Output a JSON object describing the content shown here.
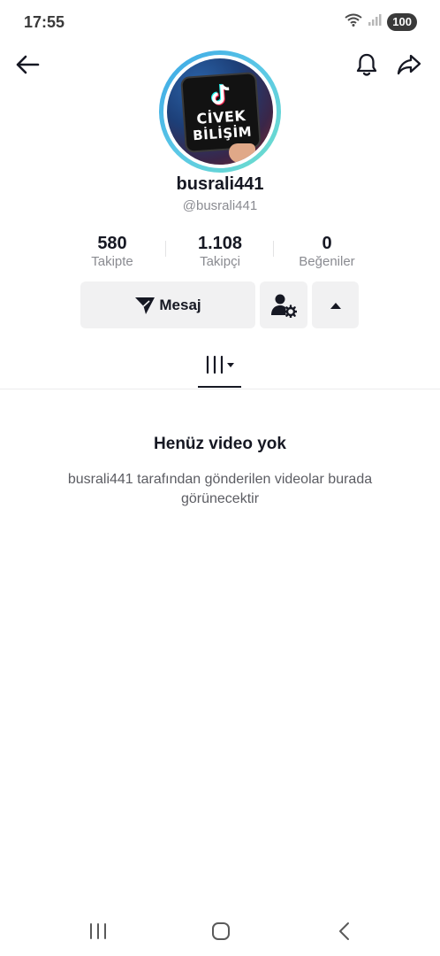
{
  "status_bar": {
    "time": "17:55",
    "battery": "100",
    "icons": [
      "wifi-icon",
      "signal-icon",
      "battery-icon"
    ]
  },
  "top_bar": {
    "icons": [
      "back-arrow-icon",
      "bell-icon",
      "share-icon"
    ]
  },
  "profile": {
    "avatar_sign_line1": "CİVEK",
    "avatar_sign_line2": "BİLİŞİM",
    "username": "busrali441",
    "handle": "@busrali441"
  },
  "stats": [
    {
      "value": "580",
      "label": "Takipte"
    },
    {
      "value": "1.108",
      "label": "Takipçi"
    },
    {
      "value": "0",
      "label": "Beğeniler"
    }
  ],
  "actions": {
    "message_label": "Mesaj",
    "icons": [
      "send-icon",
      "user-settings-icon",
      "caret-up-icon"
    ]
  },
  "tabs": {
    "active_icon": "videos-grid-icon"
  },
  "empty_state": {
    "title": "Henüz video yok",
    "description": "busrali441 tarafından gönderilen videolar burada görünecektir"
  },
  "nav_bar": {
    "icons": [
      "recent-apps-icon",
      "home-icon",
      "back-icon"
    ]
  },
  "colors": {
    "text_primary": "#161823",
    "text_secondary": "#8a8b91",
    "button_bg": "#f1f1f2",
    "avatar_ring_start": "#3ba6e6",
    "avatar_ring_end": "#6ee0c9"
  }
}
